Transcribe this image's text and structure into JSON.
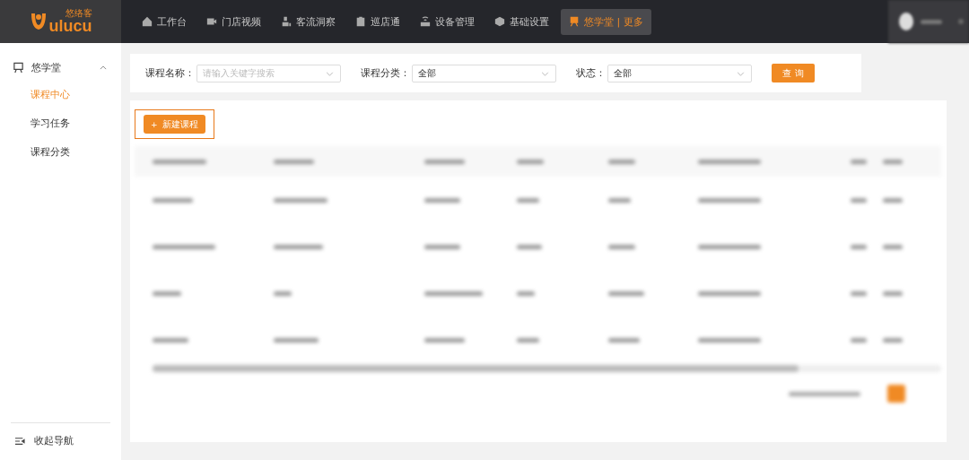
{
  "header": {
    "logo": {
      "mark": "ulucu",
      "name": "悠络客"
    },
    "nav": [
      {
        "label": "工作台",
        "selected": false
      },
      {
        "label": "门店视频",
        "selected": false
      },
      {
        "label": "客流洞察",
        "selected": false
      },
      {
        "label": "巡店通",
        "selected": false
      },
      {
        "label": "设备管理",
        "selected": false
      },
      {
        "label": "基础设置",
        "selected": false
      },
      {
        "label": "悠学堂 | 更多",
        "selected": true
      }
    ]
  },
  "sidebar": {
    "group": {
      "label": "悠学堂",
      "expanded": true,
      "items": [
        {
          "label": "课程中心",
          "selected": true
        },
        {
          "label": "学习任务",
          "selected": false
        },
        {
          "label": "课程分类",
          "selected": false
        }
      ]
    },
    "collapse": "收起导航"
  },
  "filters": [
    {
      "label": "课程名称：",
      "placeholder": "请输入关键字搜索"
    },
    {
      "label": "课程分类：",
      "value": "全部"
    },
    {
      "label": "状态：",
      "value": "全部"
    }
  ],
  "search_button": "查 询",
  "new_button": {
    "icon": "+",
    "label": "新建课程",
    "highlighted": true
  }
}
